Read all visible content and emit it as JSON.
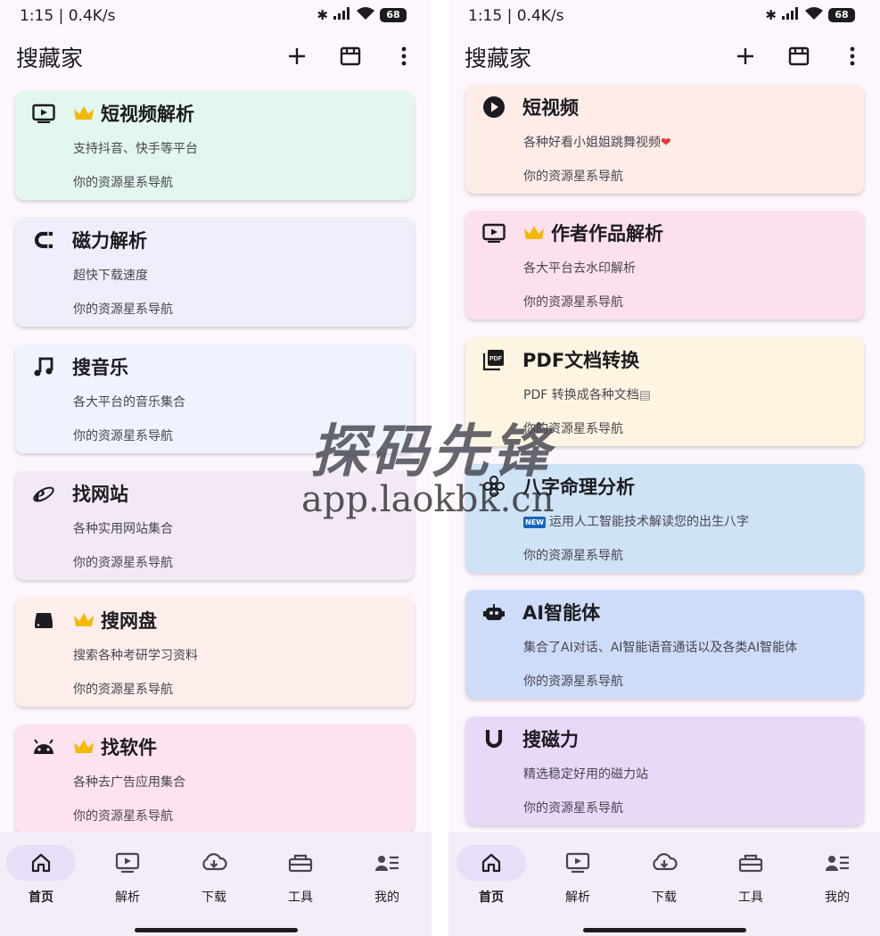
{
  "status": {
    "time": "1:15",
    "network_speed": "0.4K/s",
    "battery": "68"
  },
  "app": {
    "title": "搜藏家"
  },
  "left": {
    "cards": [
      {
        "title": "短视频解析",
        "subtitle": "支持抖音、快手等平台",
        "footer": "你的资源星系导航",
        "bg": "#e2f7ee",
        "icon": "tv-play-icon",
        "premium": true
      },
      {
        "title": "磁力解析",
        "subtitle": "超快下载速度",
        "footer": "你的资源星系导航",
        "bg": "#f1eefb",
        "icon": "magnet-icon",
        "premium": false
      },
      {
        "title": "搜音乐",
        "subtitle": "各大平台的音乐集合",
        "footer": "你的资源星系导航",
        "bg": "#eef3fd",
        "icon": "music-note-icon",
        "premium": false
      },
      {
        "title": "找网站",
        "subtitle": "各种实用网站集合",
        "footer": "你的资源星系导航",
        "bg": "#f3e9f6",
        "icon": "internet-explorer-icon",
        "premium": false
      },
      {
        "title": "搜网盘",
        "subtitle": "搜索各种考研学习资料",
        "footer": "你的资源星系导航",
        "bg": "#fdeeec",
        "icon": "hard-drive-icon",
        "premium": true
      },
      {
        "title": "找软件",
        "subtitle": "各种去广告应用集合",
        "footer": "你的资源星系导航",
        "bg": "#fde2f0",
        "icon": "android-icon",
        "premium": true
      }
    ]
  },
  "right": {
    "cards": [
      {
        "title": "短视频",
        "subtitle": "各种好看小姐姐跳舞视频",
        "footer": "你的资源星系导航",
        "bg": "#fdece8",
        "icon": "play-circle-icon",
        "premium": false
      },
      {
        "title": "作者作品解析",
        "subtitle": "各大平台去水印解析",
        "footer": "你的资源星系导航",
        "bg": "#fde0ee",
        "icon": "tv-play-icon",
        "premium": true
      },
      {
        "title": "PDF文档转换",
        "subtitle": "PDF 转换成各种文档",
        "footer": "你的资源星系导航",
        "bg": "#fdf5e1",
        "icon": "pdf-icon",
        "premium": false
      },
      {
        "title": "八字命理分析",
        "subtitle": "运用人工智能技术解读您的出生八字",
        "footer": "你的资源星系导航",
        "bg": "#cfe3f6",
        "icon": "flower-icon",
        "premium": false
      },
      {
        "title": "AI智能体",
        "subtitle": "集合了AI对话、AI智能语音通话以及各类AI智能体",
        "footer": "你的资源星系导航",
        "bg": "#cddcf8",
        "icon": "robot-icon",
        "premium": false
      },
      {
        "title": "搜磁力",
        "subtitle": "精选稳定好用的磁力站",
        "footer": "你的资源星系导航",
        "bg": "#e8d9f8",
        "icon": "magnet-u-icon",
        "premium": false
      }
    ]
  },
  "nav": {
    "items": [
      {
        "label": "首页",
        "icon": "home-icon",
        "active": true
      },
      {
        "label": "解析",
        "icon": "tv-play-icon",
        "active": false
      },
      {
        "label": "下载",
        "icon": "cloud-download-icon",
        "active": false
      },
      {
        "label": "工具",
        "icon": "toolbox-icon",
        "active": false
      },
      {
        "label": "我的",
        "icon": "profile-list-icon",
        "active": false
      }
    ]
  },
  "badge": {
    "new": "NEW"
  },
  "watermark": {
    "title": "探码先锋",
    "url": "app.laokbk.cn"
  },
  "colors": {
    "crown": "#f5b800",
    "nav_bg": "#f3edf7",
    "nav_active": "#e8def8",
    "page_bg": "#fdf7fd"
  }
}
